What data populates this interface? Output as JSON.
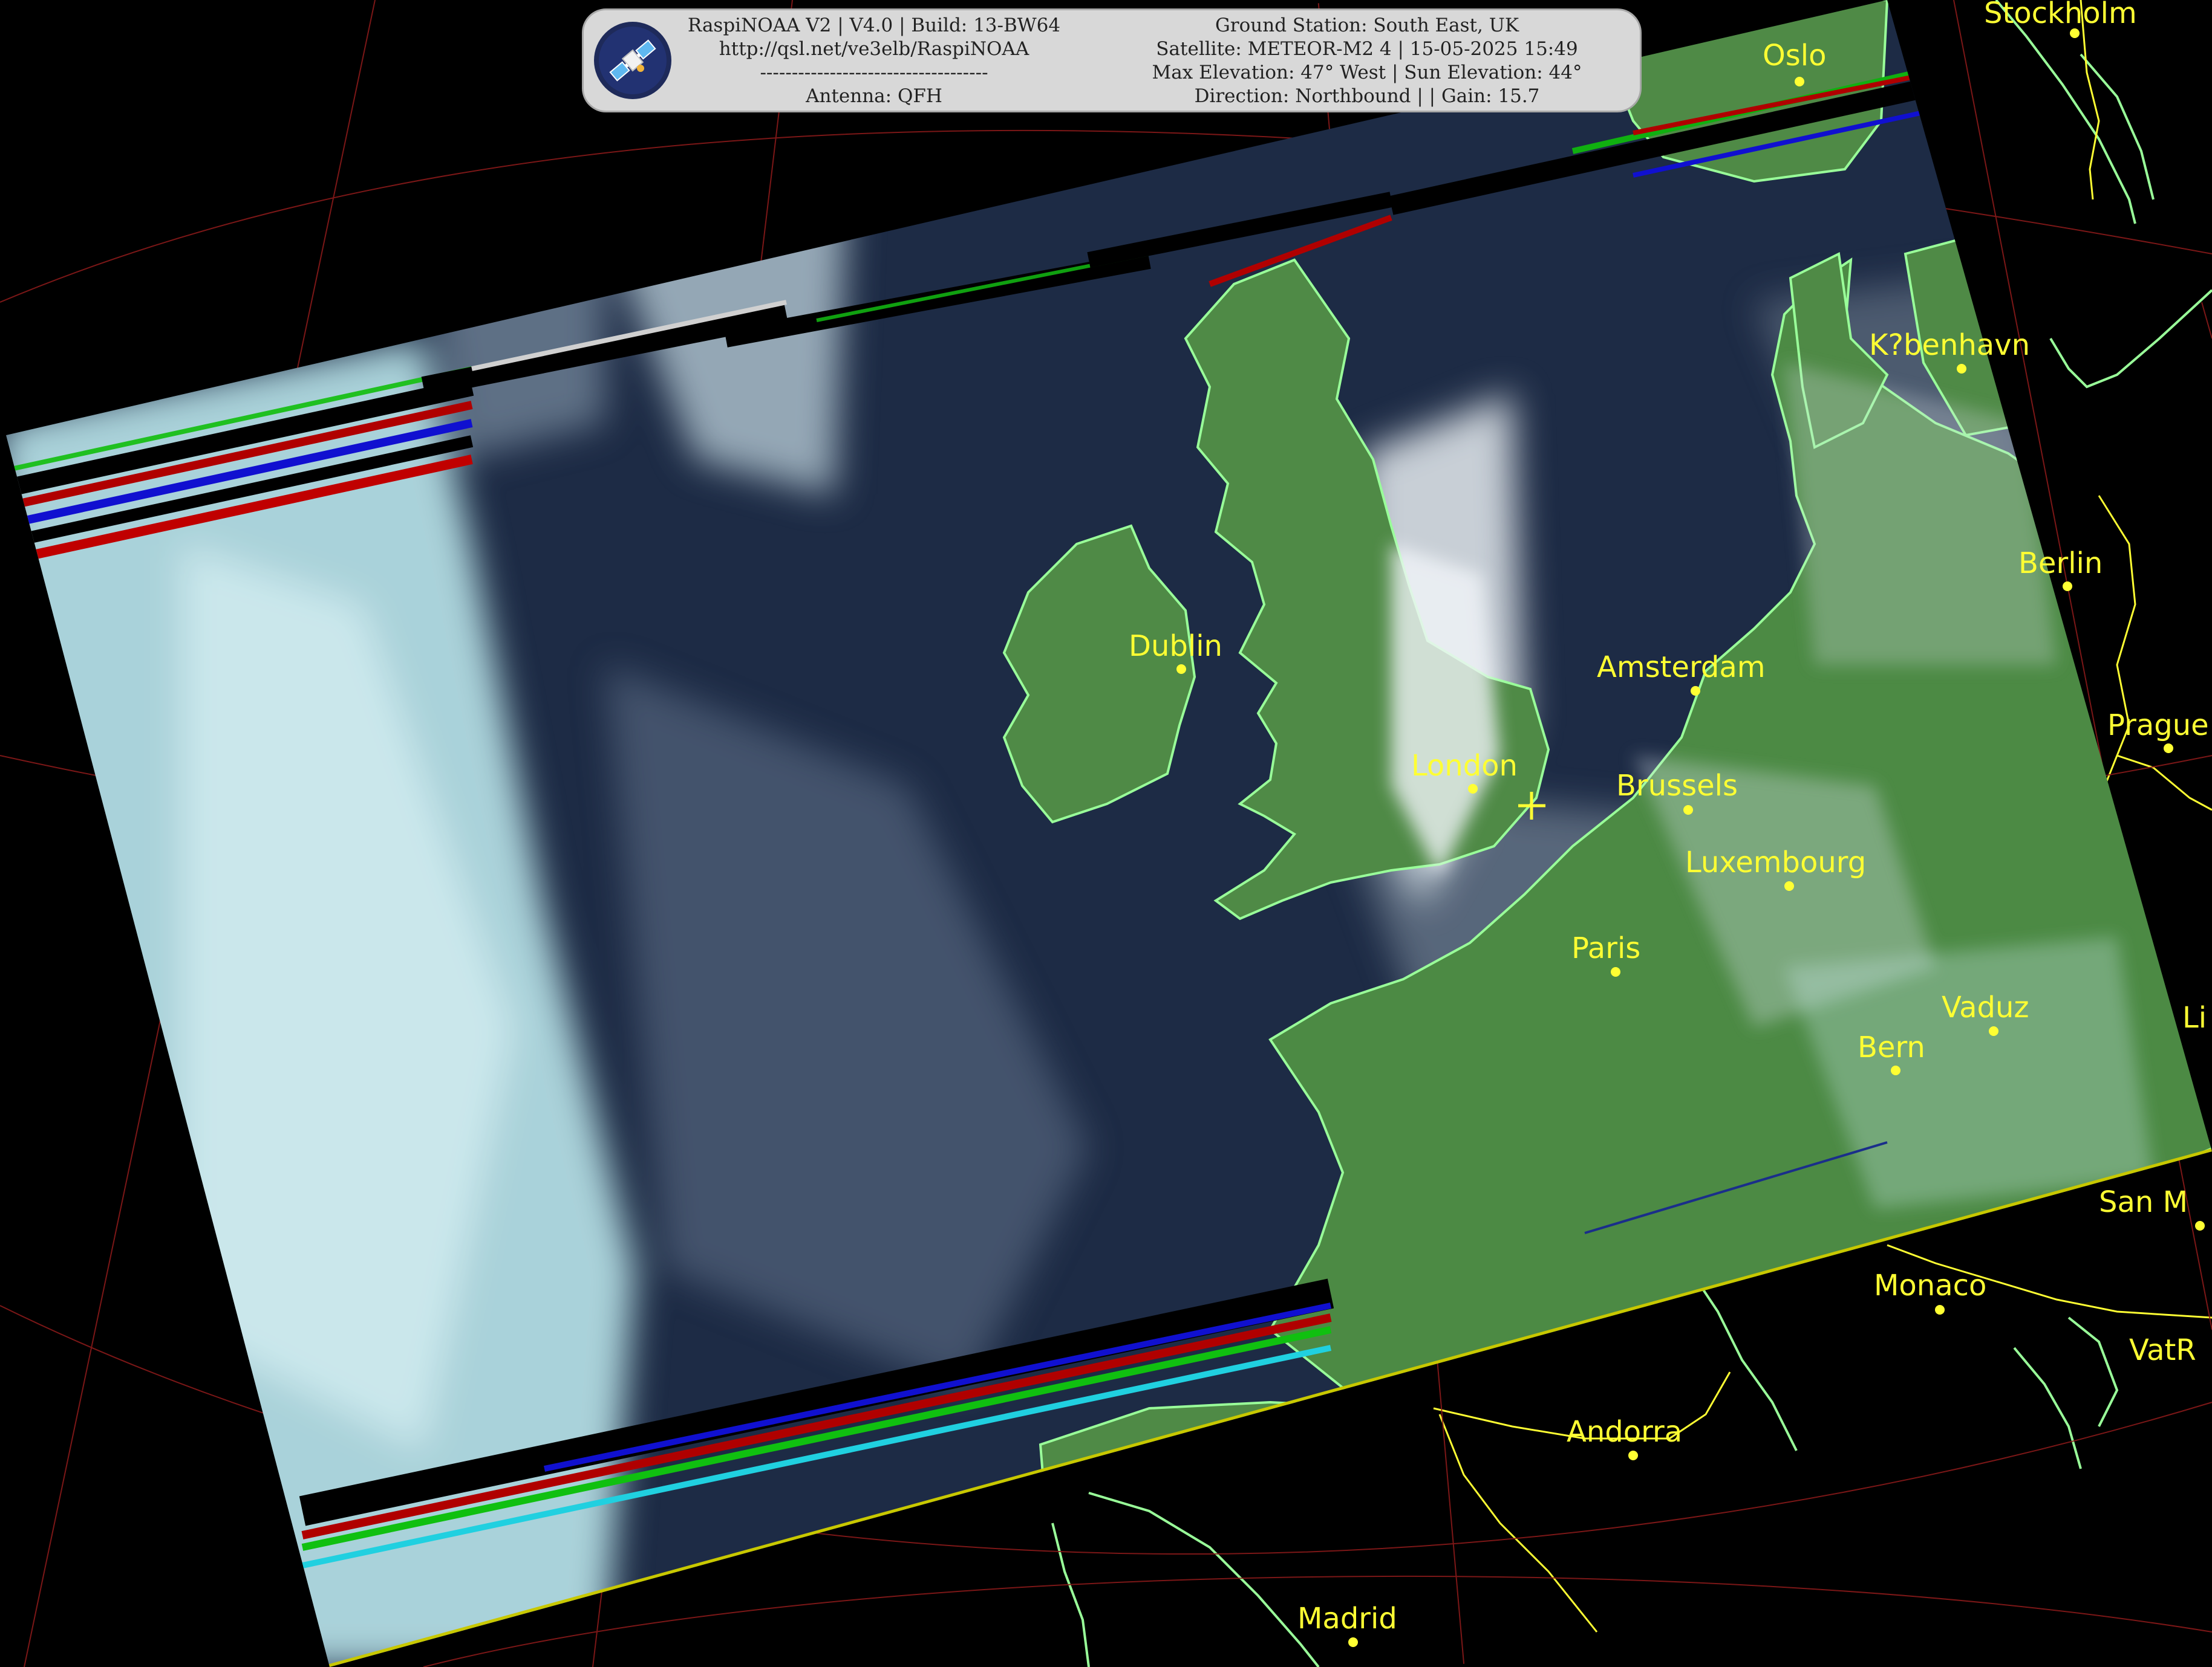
{
  "banner": {
    "line1_left": "RaspiNOAA V2 | V4.0 | Build: 13-BW64",
    "line2_left": "http://qsl.net/ve3elb/RaspiNOAA",
    "line3_left": "------------------------------------",
    "line4_left": "Antenna: QFH",
    "line1_right": "Ground Station: South East, UK",
    "line2_right": "Satellite: METEOR-M2 4 | 15-05-2025 15:49",
    "line3_right": "Max Elevation: 47° West | Sun Elevation: 44°",
    "line4_right": "Direction: Northbound | | Gain: 15.7",
    "logo_icon": "satellite-icon"
  },
  "cities": [
    {
      "name": "Stockholm"
    },
    {
      "name": "Oslo"
    },
    {
      "name": "K?benhavn"
    },
    {
      "name": "Berlin"
    },
    {
      "name": "Dublin"
    },
    {
      "name": "Amsterdam"
    },
    {
      "name": "London"
    },
    {
      "name": "Brussels"
    },
    {
      "name": "Prague"
    },
    {
      "name": "Luxembourg"
    },
    {
      "name": "Paris"
    },
    {
      "name": "Vaduz"
    },
    {
      "name": "Bern"
    },
    {
      "name": "San M"
    },
    {
      "name": "Monaco"
    },
    {
      "name": "VatR"
    },
    {
      "name": "Andorra"
    },
    {
      "name": "Madrid"
    },
    {
      "name": "Li"
    }
  ],
  "colors": {
    "background": "#000000",
    "city_marker": "#ffff33",
    "coastline": "#99ff99",
    "border": "#ffff33",
    "graticule": "#a02020",
    "ocean": "#1d2b45",
    "land": "#4f8a46",
    "cloud": "#bfe9ee"
  }
}
